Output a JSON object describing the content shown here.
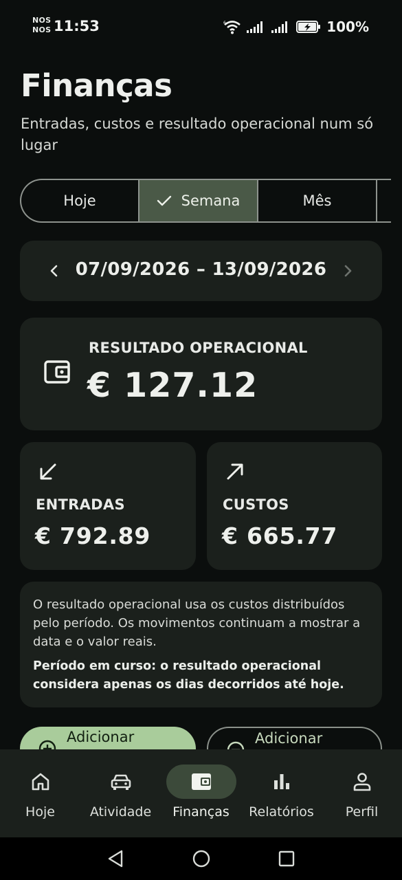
{
  "status_bar": {
    "carrier_line1": "NOS",
    "carrier_line2": "NOS",
    "time": "11:53",
    "battery": "100%",
    "icons": [
      "wifi-icon",
      "signal-icon",
      "signal-icon",
      "battery-charging-icon"
    ]
  },
  "header": {
    "title": "Finanças",
    "subtitle": "Entradas, custos e resultado operacional num só lugar"
  },
  "period_tabs": [
    {
      "label": "Hoje",
      "selected": false
    },
    {
      "label": "Semana",
      "selected": true
    },
    {
      "label": "Mês",
      "selected": false
    }
  ],
  "date_range": "07/09/2026 – 13/09/2026",
  "result": {
    "label": "RESULTADO OPERACIONAL",
    "value": "€ 127.12",
    "icon": "wallet-icon"
  },
  "income": {
    "label": "ENTRADAS",
    "value": "€ 792.89",
    "icon": "arrow-down-left-icon"
  },
  "costs": {
    "label": "CUSTOS",
    "value": "€ 665.77",
    "icon": "arrow-up-right-icon"
  },
  "info": {
    "text": "O resultado operacional usa os custos distribuídos pelo período. Os movimentos continuam a mostrar a data e o valor reais.",
    "bold": "Período em curso: o resultado operacional considera apenas os dias decorridos até hoje."
  },
  "actions": {
    "add_income": "Adicionar",
    "add_cost": "Adicionar"
  },
  "bottom_nav": [
    {
      "label": "Hoje",
      "icon": "home-icon",
      "active": false
    },
    {
      "label": "Atividade",
      "icon": "car-icon",
      "active": false
    },
    {
      "label": "Finanças",
      "icon": "wallet-icon",
      "active": true
    },
    {
      "label": "Relatórios",
      "icon": "bar-chart-icon",
      "active": false
    },
    {
      "label": "Perfil",
      "icon": "person-icon",
      "active": false
    }
  ],
  "colors": {
    "background": "#0b0e0d",
    "card": "#1b201c",
    "accent": "#a9cc9b",
    "selected_segment": "#4a5947",
    "nav_active": "#3c4a3a"
  }
}
